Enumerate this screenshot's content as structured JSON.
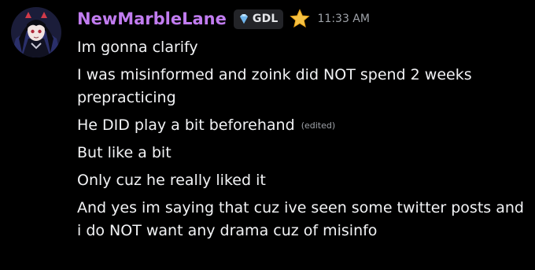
{
  "message": {
    "author": "NewMarbleLane",
    "author_color": "#c17cf0",
    "avatar_icon": "avatar-anime-character-icon",
    "tag": {
      "icon": "gem-icon",
      "label": "GDL"
    },
    "badge_icon": "star-icon",
    "timestamp": "11:33 AM",
    "lines": [
      {
        "text": "Im gonna clarify"
      },
      {
        "text": "I was misinformed and zoink did NOT spend 2 weeks prepracticing"
      },
      {
        "text": "He DID play a bit beforehand",
        "edited": "(edited)"
      },
      {
        "text": "But like a bit"
      },
      {
        "text": "Only cuz he really liked it"
      },
      {
        "text": "And yes im saying that cuz ive seen some twitter posts and i do NOT want any drama cuz of misinfo"
      }
    ]
  }
}
